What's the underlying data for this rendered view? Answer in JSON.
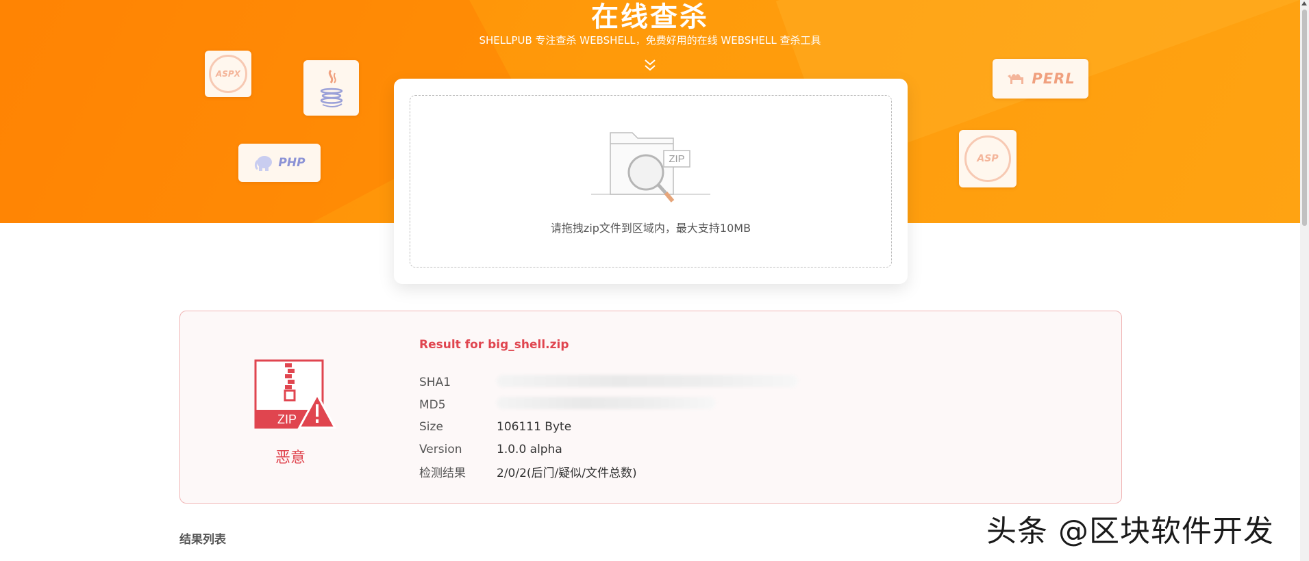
{
  "hero": {
    "title": "在线查杀",
    "subtitle": "SHELLPUB 专注查杀 WEBSHELL，免费好用的在线 WEBSHELL 查杀工具",
    "badges": {
      "aspx": "ASPX",
      "php": "PHP",
      "perl": "PERL",
      "asp": "ASP"
    }
  },
  "upload": {
    "zip_tag": "ZIP",
    "instruction": "请拖拽zip文件到区域内，最大支持10MB"
  },
  "result": {
    "title": "Result for big_shell.zip",
    "status_label": "恶意",
    "icon_zip_tag": "ZIP",
    "rows": [
      {
        "key": "SHA1",
        "value": ""
      },
      {
        "key": "MD5",
        "value": ""
      },
      {
        "key": "Size",
        "value": "106111 Byte"
      },
      {
        "key": "Version",
        "value": "1.0.0 alpha"
      },
      {
        "key": "检测结果",
        "value": "2/0/2(后门/疑似/文件总数)"
      }
    ]
  },
  "results_list": {
    "title": "结果列表"
  },
  "watermark": "头条 @区块软件开发",
  "colors": {
    "brand_orange": "#ff9208",
    "danger_red": "#e0454f"
  }
}
